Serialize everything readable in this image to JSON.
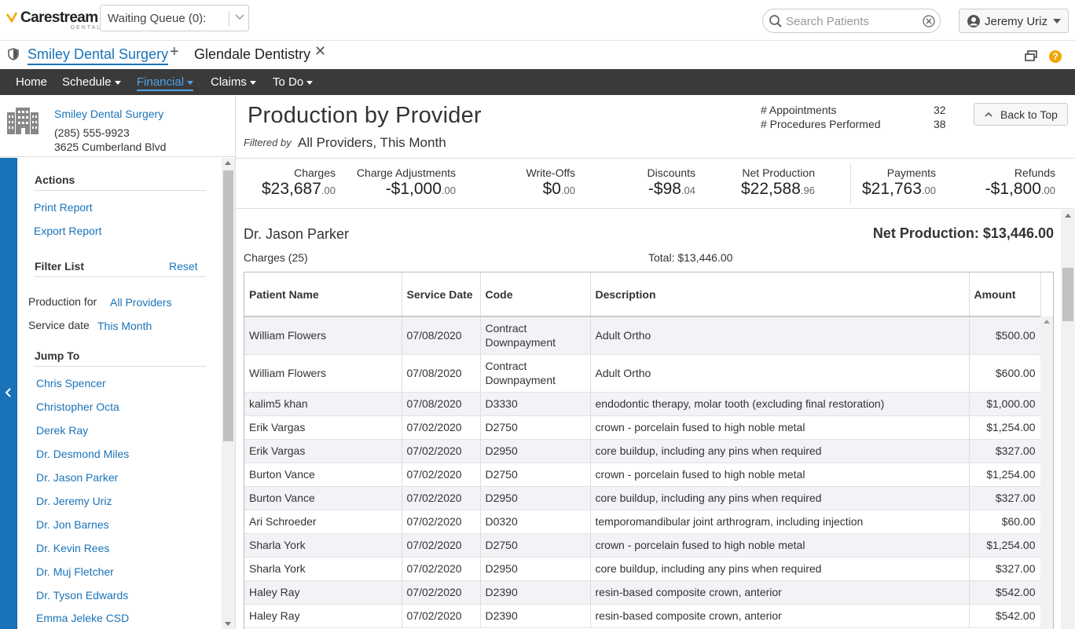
{
  "header": {
    "logo_text": "Carestream",
    "logo_sub": "DENTAL",
    "queue_label": "Waiting Queue (0):",
    "search_placeholder": "Search Patients",
    "user_name": "Jeremy Uriz",
    "help_glyph": "?"
  },
  "practice_tabs": [
    {
      "label": "Smiley Dental Surgery",
      "active": true
    },
    {
      "label": "Glendale Dentistry",
      "active": false
    }
  ],
  "nav": [
    {
      "label": "Home",
      "dropdown": false
    },
    {
      "label": "Schedule",
      "dropdown": true
    },
    {
      "label": "Financial",
      "dropdown": true,
      "active": true
    },
    {
      "label": "Claims",
      "dropdown": true
    },
    {
      "label": "To Do",
      "dropdown": true
    }
  ],
  "office": {
    "name": "Smiley Dental Surgery",
    "phone": "(285) 555-9923",
    "address": "3625 Cumberland Blvd"
  },
  "sidebar": {
    "actions_title": "Actions",
    "print_label": "Print Report",
    "export_label": "Export Report",
    "filter_title": "Filter List",
    "reset_label": "Reset",
    "production_for_label": "Production for",
    "production_for_value": "All Providers",
    "service_date_label": "Service date",
    "service_date_value": "This Month",
    "jump_title": "Jump To",
    "jump_items": [
      "Chris Spencer",
      "Christopher Octa",
      "Derek Ray",
      "Dr. Desmond Miles",
      "Dr. Jason Parker",
      "Dr. Jeremy Uriz",
      "Dr. Jon Barnes",
      "Dr. Kevin Rees",
      "Dr. Muj Fletcher",
      "Dr. Tyson Edwards",
      "Emma Jeleke CSD"
    ]
  },
  "report": {
    "title": "Production by Provider",
    "filtered_by_label": "Filtered by",
    "filtered_by_value": "All Providers, This Month",
    "appointments_label": "# Appointments",
    "appointments_value": "32",
    "procedures_label": "# Procedures Performed",
    "procedures_value": "38",
    "back_to_top_label": "Back to Top"
  },
  "summary": [
    {
      "label": "Charges",
      "value": "$23,687",
      "cents": ".00"
    },
    {
      "label": "Charge Adjustments",
      "value": "-$1,000",
      "cents": ".00"
    },
    {
      "label": "Write-Offs",
      "value": "$0",
      "cents": ".00"
    },
    {
      "label": "Discounts",
      "value": "-$98",
      "cents": ".04"
    },
    {
      "label": "Net Production",
      "value": "$22,588",
      "cents": ".96"
    },
    {
      "label": "Payments",
      "value": "$21,763",
      "cents": ".00"
    },
    {
      "label": "Refunds",
      "value": "-$1,800",
      "cents": ".00"
    }
  ],
  "provider": {
    "name": "Dr. Jason Parker",
    "net_production": "Net Production: $13,446.00",
    "charges_count": "Charges (25)",
    "charges_total": "Total: $13,446.00"
  },
  "table": {
    "columns": [
      "Patient Name",
      "Service Date",
      "Code",
      "Description",
      "Amount"
    ],
    "rows": [
      {
        "patient": "William Flowers",
        "date": "07/08/2020",
        "code": "Contract Downpayment",
        "desc": "Adult Ortho",
        "amount": "$500.00"
      },
      {
        "patient": "William Flowers",
        "date": "07/08/2020",
        "code": "Contract Downpayment",
        "desc": "Adult Ortho",
        "amount": "$600.00"
      },
      {
        "patient": "kalim5 khan",
        "date": "07/08/2020",
        "code": "D3330",
        "desc": "endodontic therapy, molar tooth (excluding final restoration)",
        "amount": "$1,000.00"
      },
      {
        "patient": "Erik Vargas",
        "date": "07/02/2020",
        "code": "D2750",
        "desc": "crown - porcelain fused to high noble metal",
        "amount": "$1,254.00"
      },
      {
        "patient": "Erik Vargas",
        "date": "07/02/2020",
        "code": "D2950",
        "desc": "core buildup, including any pins when required",
        "amount": "$327.00"
      },
      {
        "patient": "Burton Vance",
        "date": "07/02/2020",
        "code": "D2750",
        "desc": "crown - porcelain fused to high noble metal",
        "amount": "$1,254.00"
      },
      {
        "patient": "Burton Vance",
        "date": "07/02/2020",
        "code": "D2950",
        "desc": "core buildup, including any pins when required",
        "amount": "$327.00"
      },
      {
        "patient": "Ari Schroeder",
        "date": "07/02/2020",
        "code": "D0320",
        "desc": "temporomandibular joint arthrogram, including injection",
        "amount": "$60.00"
      },
      {
        "patient": "Sharla York",
        "date": "07/02/2020",
        "code": "D2750",
        "desc": "crown - porcelain fused to high noble metal",
        "amount": "$1,254.00"
      },
      {
        "patient": "Sharla York",
        "date": "07/02/2020",
        "code": "D2950",
        "desc": "core buildup, including any pins when required",
        "amount": "$327.00"
      },
      {
        "patient": "Haley Ray",
        "date": "07/02/2020",
        "code": "D2390",
        "desc": "resin-based composite crown, anterior",
        "amount": "$542.00"
      },
      {
        "patient": "Haley Ray",
        "date": "07/02/2020",
        "code": "D2390",
        "desc": "resin-based composite crown, anterior",
        "amount": "$542.00"
      }
    ]
  },
  "colors": {
    "accent": "#1a73b8",
    "nav_bg": "#3a3a3a",
    "nav_active": "#4fa3e8",
    "help": "#f0a500"
  }
}
